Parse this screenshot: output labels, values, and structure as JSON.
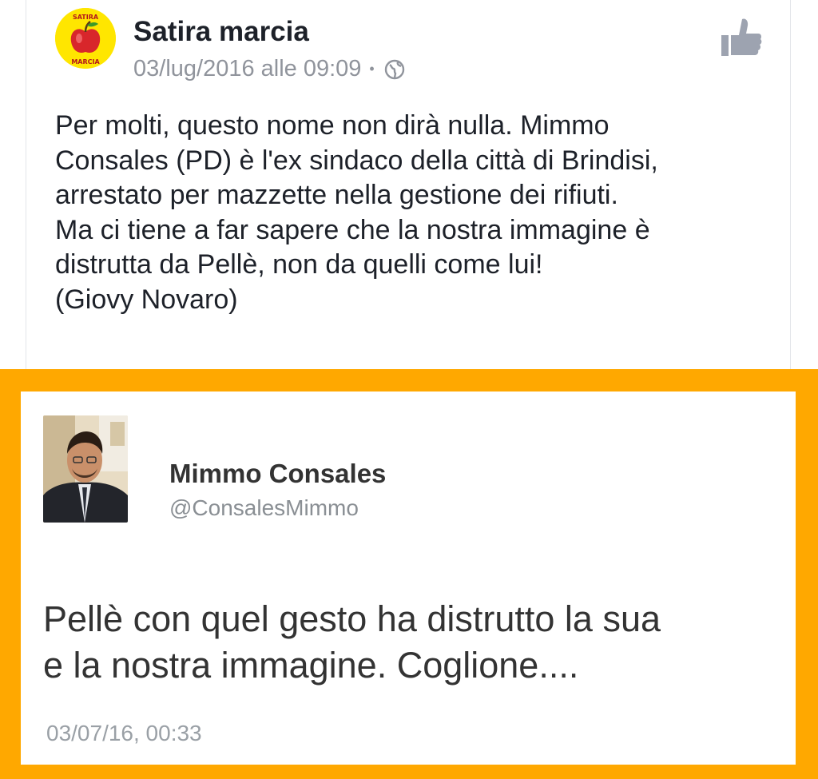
{
  "post": {
    "page_name": "Satira marcia",
    "date": "03/lug/2016 alle 09:09",
    "separator": "•",
    "avatar_text_top": "SATIRA",
    "avatar_text_bottom": "MARCIA",
    "icons": {
      "privacy": "globe-icon",
      "like": "thumbs-up-icon"
    },
    "text_lines": [
      "Per molti, questo nome non dirà nulla. Mimmo",
      "Consales (PD) è l'ex sindaco della città di Brindisi,",
      "arrestato per mazzette nella gestione dei rifiuti.",
      "Ma ci tiene a far sapere che la nostra immagine è",
      "distrutta da Pellè, non da quelli come lui!",
      "(Giovy Novaro)"
    ]
  },
  "tweet": {
    "name": "Mimmo Consales",
    "handle": "@ConsalesMimmo",
    "text_lines": [
      "Pellè con quel gesto ha distrutto la sua",
      "e la nostra immagine. Coglione...."
    ],
    "timestamp": "03/07/16, 00:33"
  },
  "colors": {
    "frame": "#ffa800",
    "avatar_bg": "#ffe600",
    "meta_text": "#90949c"
  }
}
